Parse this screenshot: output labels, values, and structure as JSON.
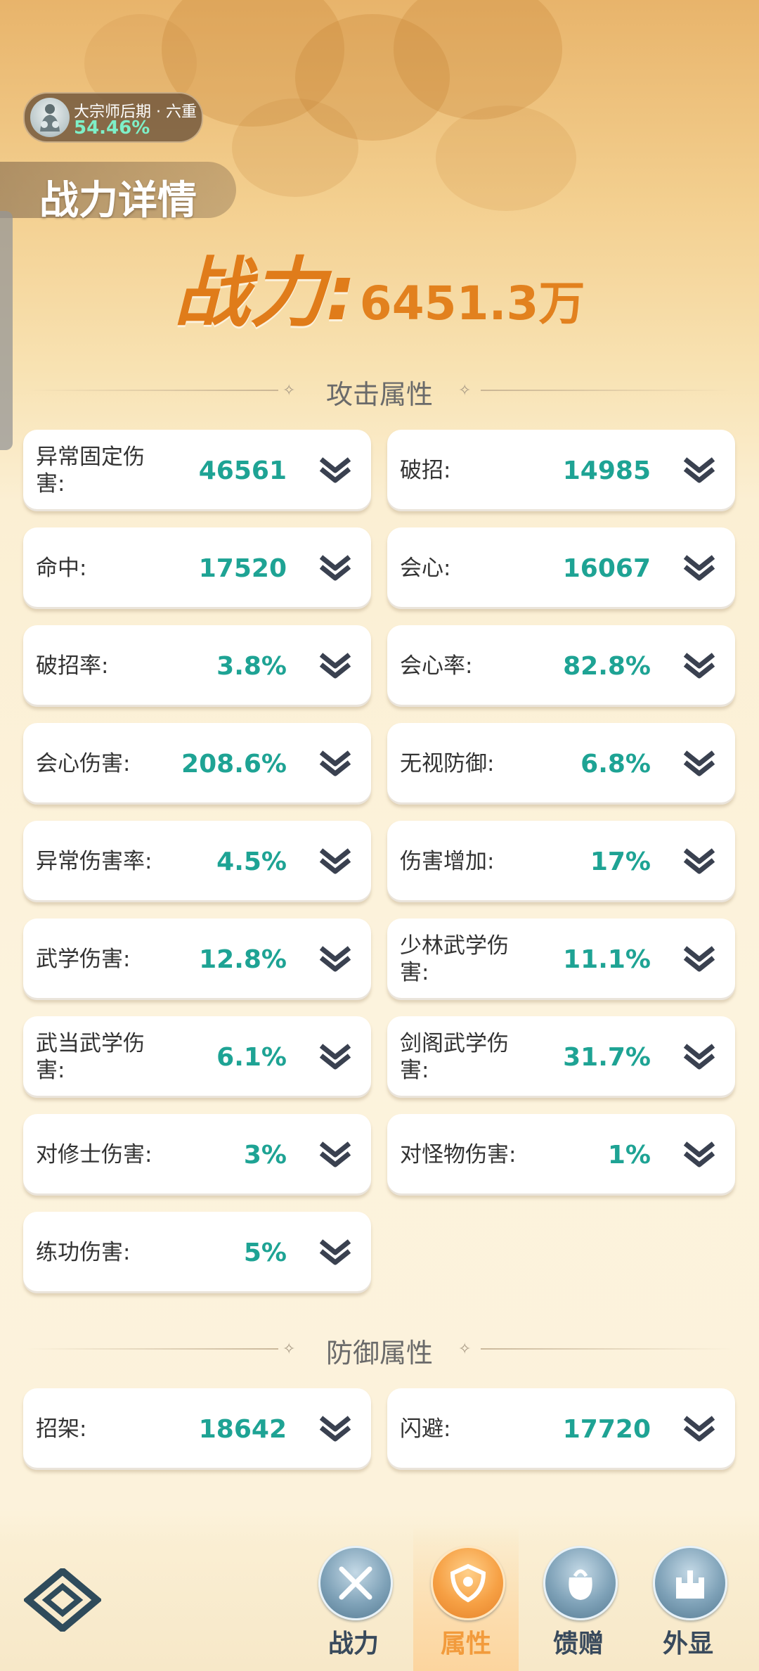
{
  "realm": {
    "name": "大宗师后期 · 六重",
    "progress": "54.46%"
  },
  "page_title": "战力详情",
  "power": {
    "label": "战力:",
    "value": "6451.3万"
  },
  "sections": {
    "attack": {
      "title": "攻击属性"
    },
    "defense": {
      "title": "防御属性"
    }
  },
  "attack_stats": [
    {
      "label": "异常固定伤害:",
      "value": "46561"
    },
    {
      "label": "破招:",
      "value": "14985"
    },
    {
      "label": "命中:",
      "value": "17520"
    },
    {
      "label": "会心:",
      "value": "16067"
    },
    {
      "label": "破招率:",
      "value": "3.8%"
    },
    {
      "label": "会心率:",
      "value": "82.8%"
    },
    {
      "label": "会心伤害:",
      "value": "208.6%"
    },
    {
      "label": "无视防御:",
      "value": "6.8%"
    },
    {
      "label": "异常伤害率:",
      "value": "4.5%"
    },
    {
      "label": "伤害增加:",
      "value": "17%"
    },
    {
      "label": "武学伤害:",
      "value": "12.8%"
    },
    {
      "label": "少林武学伤害:",
      "value": "11.1%"
    },
    {
      "label": "武当武学伤害:",
      "value": "6.1%"
    },
    {
      "label": "剑阁武学伤害:",
      "value": "31.7%"
    },
    {
      "label": "对修士伤害:",
      "value": "3%"
    },
    {
      "label": "对怪物伤害:",
      "value": "1%"
    },
    {
      "label": "练功伤害:",
      "value": "5%"
    }
  ],
  "defense_stats": [
    {
      "label": "招架:",
      "value": "18642"
    },
    {
      "label": "闪避:",
      "value": "17720"
    }
  ],
  "bottom_nav": [
    {
      "label": "战力",
      "icon": "swords-icon",
      "active": false
    },
    {
      "label": "属性",
      "icon": "shield-icon",
      "active": true
    },
    {
      "label": "馈赠",
      "icon": "gift-bag-icon",
      "active": false
    },
    {
      "label": "外显",
      "icon": "castle-icon",
      "active": false
    }
  ],
  "colors": {
    "accent": "#e07c1a",
    "value": "#1ea394",
    "nav_active": "#f29b3c"
  }
}
